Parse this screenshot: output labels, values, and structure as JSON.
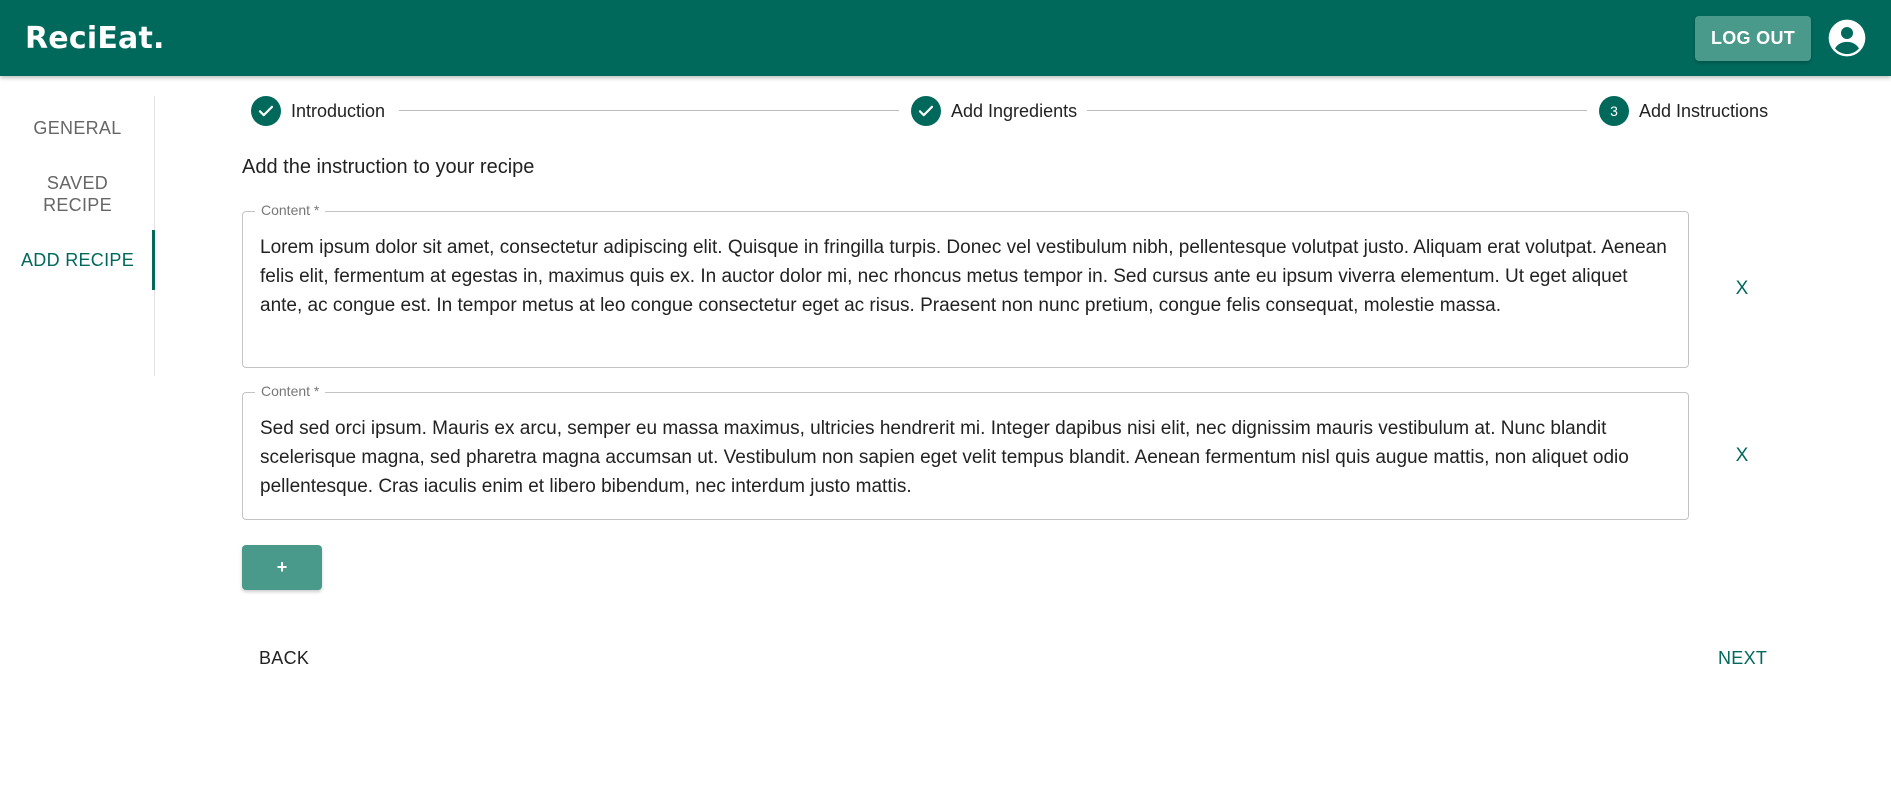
{
  "app": {
    "logo": "ReciEat.",
    "logout_label": "LOG OUT",
    "account_icon": "account-circle-icon",
    "brand_color": "#00695c",
    "button_color": "#4a9a8c"
  },
  "sidebar": {
    "items": [
      {
        "label": "GENERAL",
        "active": false
      },
      {
        "label": "SAVED RECIPE",
        "active": false
      },
      {
        "label": "ADD RECIPE",
        "active": true
      }
    ]
  },
  "stepper": {
    "steps": [
      {
        "label": "Introduction",
        "state": "completed",
        "icon": "check-icon"
      },
      {
        "label": "Add Ingredients",
        "state": "completed",
        "icon": "check-icon"
      },
      {
        "label": "Add Instructions",
        "state": "active",
        "number": "3"
      }
    ]
  },
  "main": {
    "title": "Add the instruction to your recipe",
    "instructions": [
      {
        "label": "Content *",
        "value": "Lorem ipsum dolor sit amet, consectetur adipiscing elit. Quisque in fringilla turpis. Donec vel vestibulum nibh, pellentesque volutpat justo. Aliquam erat volutpat. Aenean felis elit, fermentum at egestas in, maximus quis ex. In auctor dolor mi, nec rhoncus metus tempor in. Sed cursus ante eu ipsum viverra elementum. Ut eget aliquet ante, ac congue est. In tempor metus at leo congue consectetur eget ac risus. Praesent non nunc pretium, congue felis consequat, molestie massa.",
        "remove_label": "X"
      },
      {
        "label": "Content *",
        "value": "Sed sed orci ipsum. Mauris ex arcu, semper eu massa maximus, ultricies hendrerit mi. Integer dapibus nisi elit, nec dignissim mauris vestibulum at. Nunc blandit scelerisque magna, sed pharetra magna accumsan ut. Vestibulum non sapien eget velit tempus blandit. Aenean fermentum nisl quis augue mattis, non aliquet odio pellentesque. Cras iaculis enim et libero bibendum, nec interdum justo mattis.",
        "remove_label": "X"
      }
    ],
    "add_label": "+"
  },
  "nav": {
    "back_label": "BACK",
    "next_label": "NEXT"
  }
}
